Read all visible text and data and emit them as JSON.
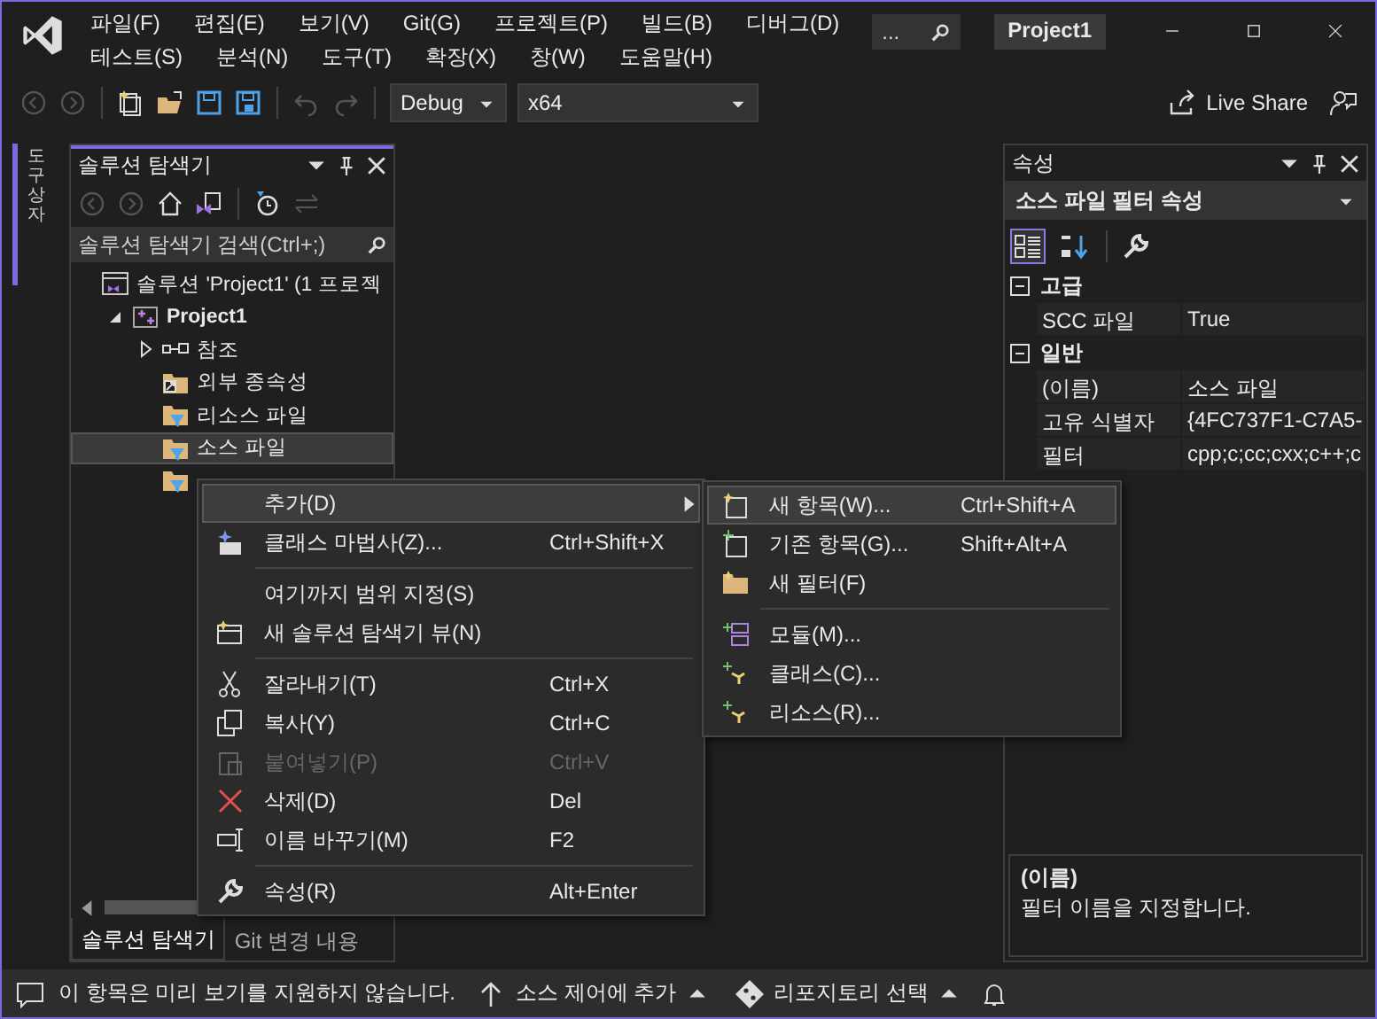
{
  "title_bar": {
    "menu_rows": [
      {
        "items": [
          "파일(F)",
          "편집(E)",
          "보기(V)",
          "Git(G)",
          "프로젝트(P)",
          "빌드(B)",
          "디버그(D)"
        ]
      },
      {
        "items": [
          "테스트(S)",
          "분석(N)",
          "도구(T)",
          "확장(X)",
          "창(W)",
          "도움말(H)"
        ]
      }
    ],
    "search": "...",
    "title": "Project1"
  },
  "toolbar": {
    "configuration": "Debug",
    "platform": "x64",
    "live_share": "Live Share"
  },
  "side_tab": {
    "label": "도구 상자"
  },
  "solution_explorer": {
    "title": "솔루션 탐색기",
    "search_placeholder": "솔루션 탐색기 검색(Ctrl+;)",
    "tree": [
      {
        "label": "솔루션 'Project1' (1 프로젝",
        "kind": "solution",
        "selected": false,
        "children": [
          {
            "label": "Project1",
            "kind": "project",
            "selected": false,
            "expanded": true,
            "children": [
              {
                "label": "참조",
                "kind": "references",
                "selected": false,
                "expanded": false
              },
              {
                "label": "외부 종속성",
                "kind": "external",
                "selected": false
              },
              {
                "label": "리소스 파일",
                "kind": "filter",
                "selected": false
              },
              {
                "label": "소스 파일",
                "kind": "filter",
                "selected": true
              },
              {
                "kind": "filter",
                "selected": false
              }
            ]
          }
        ]
      }
    ],
    "tabs": [
      {
        "label": "솔루션 탐색기",
        "selected": true
      },
      {
        "label": "Git 변경 내용",
        "selected": false
      }
    ]
  },
  "properties": {
    "title": "속성",
    "object": "소스 파일 필터 속성",
    "categories": [
      {
        "name": "고급",
        "expanded": true,
        "rows": [
          {
            "name": "SCC 파일",
            "value": "True"
          }
        ]
      },
      {
        "name": "일반",
        "expanded": true,
        "rows": [
          {
            "name": "(이름)",
            "value": "소스 파일"
          },
          {
            "name": "고유 식별자",
            "value": "{4FC737F1-C7A5-"
          },
          {
            "name": "필터",
            "value": "cpp;c;cc;cxx;c++;c"
          }
        ]
      }
    ],
    "description": {
      "title": "(이름)",
      "text": "필터 이름을 지정합니다."
    }
  },
  "context_menu": {
    "items": [
      {
        "kind": "item",
        "label": "추가(D)",
        "submenu": true,
        "selected": true,
        "disabled": false
      },
      {
        "kind": "item",
        "label": "클래스 마법사(Z)...",
        "shortcut": "Ctrl+Shift+X",
        "selected": false,
        "disabled": false
      },
      {
        "kind": "separator"
      },
      {
        "kind": "item",
        "label": "여기까지 범위 지정(S)",
        "selected": false,
        "disabled": false
      },
      {
        "kind": "item",
        "label": "새 솔루션 탐색기 뷰(N)",
        "selected": false,
        "disabled": false
      },
      {
        "kind": "separator"
      },
      {
        "kind": "item",
        "label": "잘라내기(T)",
        "shortcut": "Ctrl+X",
        "selected": false,
        "disabled": false
      },
      {
        "kind": "item",
        "label": "복사(Y)",
        "shortcut": "Ctrl+C",
        "selected": false,
        "disabled": false
      },
      {
        "kind": "item",
        "label": "붙여넣기(P)",
        "shortcut": "Ctrl+V",
        "selected": false,
        "disabled": true
      },
      {
        "kind": "item",
        "label": "삭제(D)",
        "shortcut": "Del",
        "selected": false,
        "disabled": false
      },
      {
        "kind": "item",
        "label": "이름 바꾸기(M)",
        "shortcut": "F2",
        "selected": false,
        "disabled": false
      },
      {
        "kind": "separator"
      },
      {
        "kind": "item",
        "label": "속성(R)",
        "shortcut": "Alt+Enter",
        "selected": false,
        "disabled": false
      }
    ]
  },
  "submenu": {
    "items": [
      {
        "kind": "item",
        "label": "새 항목(W)...",
        "shortcut": "Ctrl+Shift+A",
        "selected": true
      },
      {
        "kind": "item",
        "label": "기존 항목(G)...",
        "shortcut": "Shift+Alt+A",
        "selected": false
      },
      {
        "kind": "item",
        "label": "새 필터(F)",
        "selected": false
      },
      {
        "kind": "separator"
      },
      {
        "kind": "item",
        "label": "모듈(M)...",
        "selected": false
      },
      {
        "kind": "item",
        "label": "클래스(C)...",
        "selected": false
      },
      {
        "kind": "item",
        "label": "리소스(R)...",
        "selected": false
      }
    ]
  },
  "status_bar": {
    "message": "이 항목은 미리 보기를 지원하지 않습니다.",
    "source_control": "소스 제어에 추가",
    "repository": "리포지토리 선택"
  }
}
